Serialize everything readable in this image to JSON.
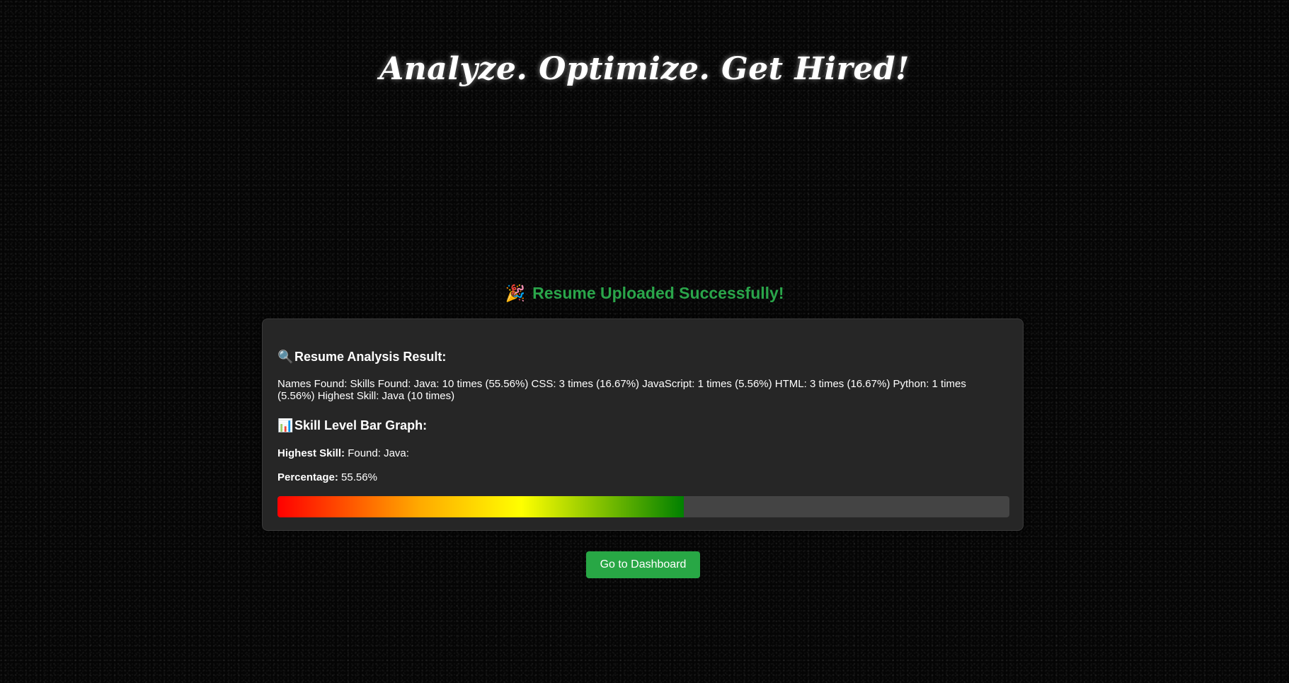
{
  "hero": {
    "title": "Analyze. Optimize. Get Hired!"
  },
  "upload": {
    "emoji": "🎉",
    "message": "Resume Uploaded Successfully!",
    "color": "#2aa54a"
  },
  "analysis": {
    "icon": "🔍",
    "icon_name": "magnifier-icon",
    "title": "Resume Analysis Result:",
    "text": "Names Found: Skills Found: Java: 10 times (55.56%) CSS: 3 times (16.67%) JavaScript: 1 times (5.56%) HTML: 3 times (16.67%) Python: 1 times (5.56%) Highest Skill: Java (10 times)"
  },
  "bar_graph": {
    "icon": "📊",
    "icon_name": "bar-chart-icon",
    "title": "Skill Level Bar Graph:",
    "highest_label": "Highest Skill:",
    "highest_value": "Found: Java:",
    "percentage_label": "Percentage:",
    "percentage_value": "55.56%",
    "fill_percent": 55.56,
    "gradient_colors": [
      "#ff0000",
      "#ffaa00",
      "#ffff00",
      "#008000"
    ],
    "track_color": "#444444"
  },
  "actions": {
    "dashboard_label": "Go to Dashboard",
    "button_color": "#28a745"
  }
}
